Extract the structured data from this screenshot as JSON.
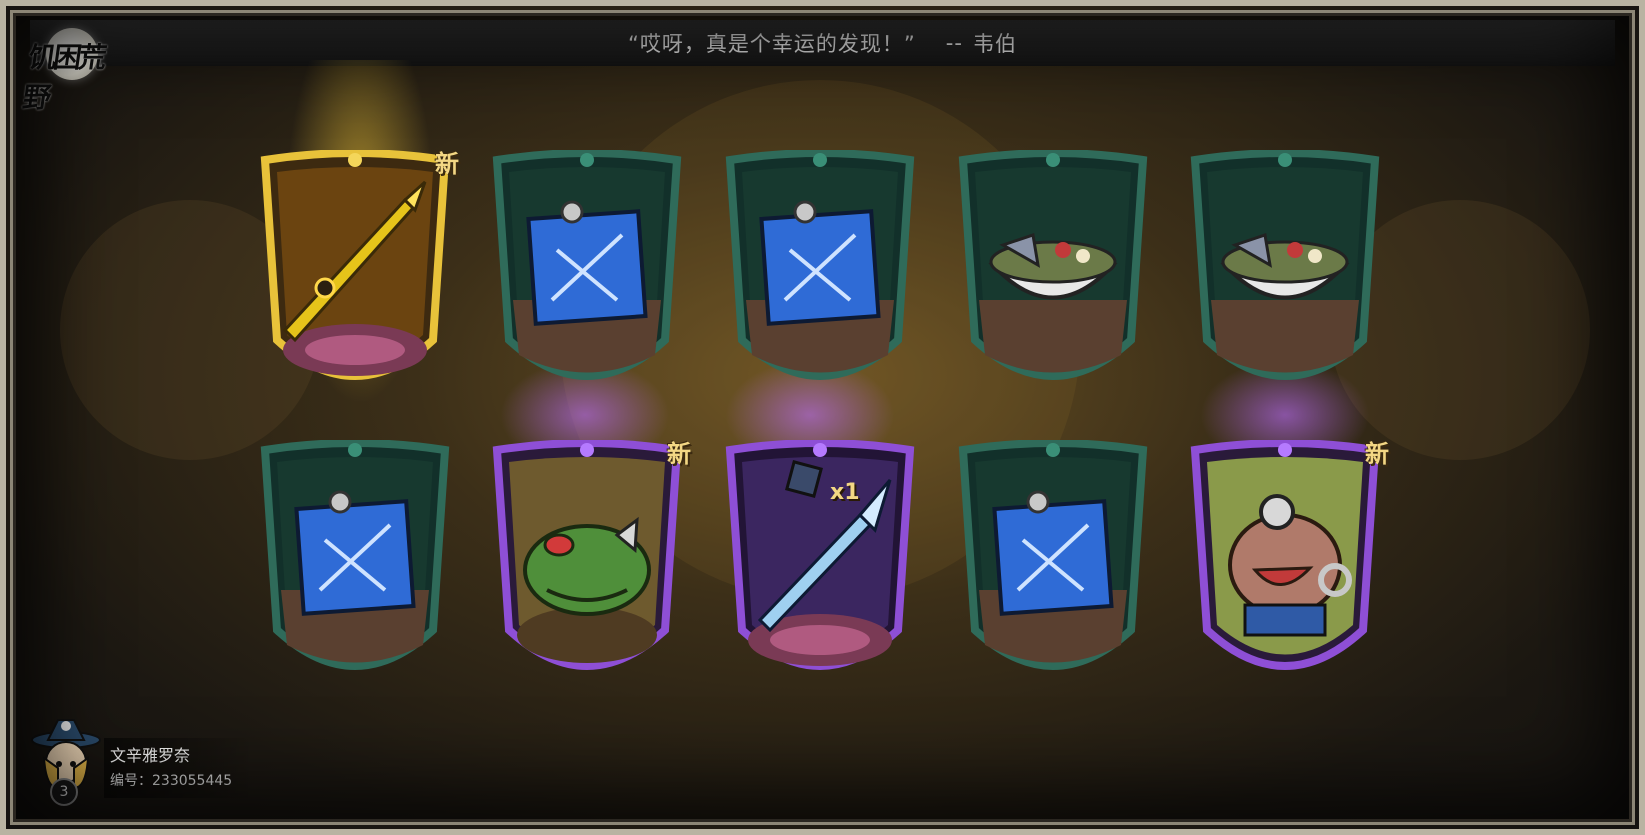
{
  "header": {
    "logo_text": "饥困荒野",
    "quote": "“哎呀，真是个幸运的发现！”",
    "quote_separator": "--",
    "quote_author": "韦伯"
  },
  "cards": [
    {
      "id": "gold-spear",
      "frame": "gold",
      "item": "golden-spear-icon",
      "is_new": true,
      "new_label": "新"
    },
    {
      "id": "blueprint-1",
      "frame": "teal",
      "item": "blueprint-icon",
      "is_new": false
    },
    {
      "id": "blueprint-2",
      "frame": "teal",
      "item": "blueprint-icon",
      "is_new": false
    },
    {
      "id": "food-bowl-1",
      "frame": "teal",
      "item": "food-bowl-icon",
      "is_new": false
    },
    {
      "id": "food-bowl-2",
      "frame": "teal",
      "item": "food-bowl-icon",
      "is_new": false
    },
    {
      "id": "blueprint-3",
      "frame": "teal",
      "item": "blueprint-icon",
      "is_new": false
    },
    {
      "id": "frog-monster",
      "frame": "purple",
      "item": "frog-monster-icon",
      "is_new": true,
      "new_label": "新"
    },
    {
      "id": "ice-spear",
      "frame": "purple",
      "item": "ice-spear-icon",
      "is_new": false,
      "quantity": "x1"
    },
    {
      "id": "blueprint-4",
      "frame": "teal",
      "item": "blueprint-icon",
      "is_new": false
    },
    {
      "id": "mole-creature",
      "frame": "purple",
      "item": "mole-creature-icon",
      "is_new": true,
      "new_label": "新"
    }
  ],
  "player": {
    "name": "文辛雅罗奈",
    "id_label": "编号：",
    "id_value": "233055445",
    "level": "3"
  },
  "colors": {
    "gold_frame": "#e8c23a",
    "teal_frame": "#2f6b5a",
    "purple_frame": "#8e4fd6",
    "new_tag": "#f3d784",
    "quote_text": "#f2f2f2"
  }
}
